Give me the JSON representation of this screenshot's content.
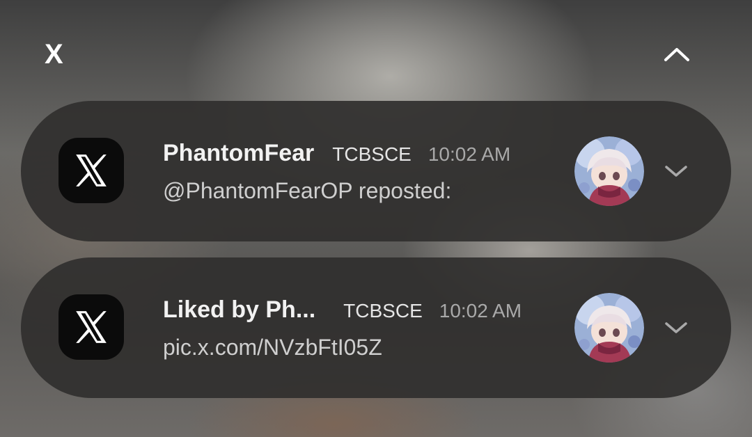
{
  "group": {
    "app_name": "X",
    "collapse_icon": "chevron-up-icon"
  },
  "notifications": [
    {
      "app_icon": "x-logo-icon",
      "title": "PhantomFear",
      "account": "TCBSCE",
      "time": "10:02 AM",
      "body": "@PhantomFearOP reposted:",
      "avatar": "anime-character-avatar",
      "expand_icon": "chevron-down-icon"
    },
    {
      "app_icon": "x-logo-icon",
      "title": "Liked by Ph...",
      "account": "TCBSCE",
      "time": "10:02 AM",
      "body": "pic.x.com/NVzbFtI05Z",
      "avatar": "anime-character-avatar",
      "expand_icon": "chevron-down-icon"
    }
  ],
  "colors": {
    "card_background": "#302f2e",
    "title_text": "#f2f2f2",
    "time_text": "#a9a9a9",
    "body_text": "#cfcfcf",
    "app_icon_background": "#0b0b0b"
  }
}
